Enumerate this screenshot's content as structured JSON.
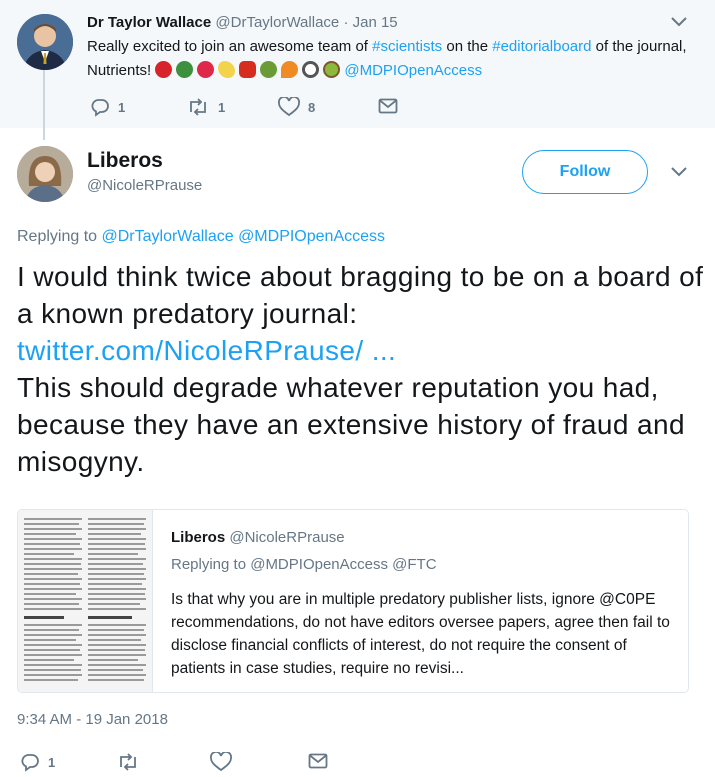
{
  "parent": {
    "name": "Dr Taylor Wallace",
    "handle": "@DrTaylorWallace",
    "separator": "·",
    "date": "Jan 15",
    "text_1": "Really excited to join an awesome team of ",
    "hashtag_1": "#scientists",
    "text_2": " on the ",
    "hashtag_2": "#editorialboard",
    "text_3": " of the journal, Nutrients! ",
    "mention": "@MDPIOpenAccess",
    "emojis": [
      "apple-emoji",
      "broccoli-emoji",
      "strawberry-emoji",
      "banana-emoji",
      "pepper-emoji",
      "avocado-emoji",
      "carrot-emoji",
      "magnifier-emoji",
      "kiwi-emoji"
    ],
    "actions": {
      "replies": "1",
      "retweets": "1",
      "likes": "8"
    }
  },
  "reply": {
    "name": "Liberos",
    "handle": "@NicoleRPrause",
    "follow_label": "Follow",
    "replying_prefix": "Replying to ",
    "replying_to": "@DrTaylorWallace @MDPIOpenAccess",
    "text_1": "I would think twice about bragging to be on a board of a known predatory journal:",
    "link": "twitter.com/NicoleRPrause/ ...",
    "text_2": "This should degrade whatever reputation you had, because they have an extensive history of fraud and misogyny.",
    "timestamp": "9:34 AM - 19 Jan 2018",
    "actions": {
      "replies": "1"
    }
  },
  "quoted": {
    "name": "Liberos",
    "handle": "@NicoleRPrause",
    "replying": "Replying to @MDPIOpenAccess @FTC",
    "text": "Is that why you are in multiple predatory publisher lists, ignore @C0PE recommendations, do not have editors oversee papers, agree then fail to disclose financial conflicts of interest, do not require the consent of patients in case studies, require no revisi..."
  },
  "colors": {
    "accent": "#1da1f2",
    "muted": "#657786",
    "text": "#14171a",
    "parent_bg": "#f5f8fa",
    "border": "#e1e8ed"
  }
}
